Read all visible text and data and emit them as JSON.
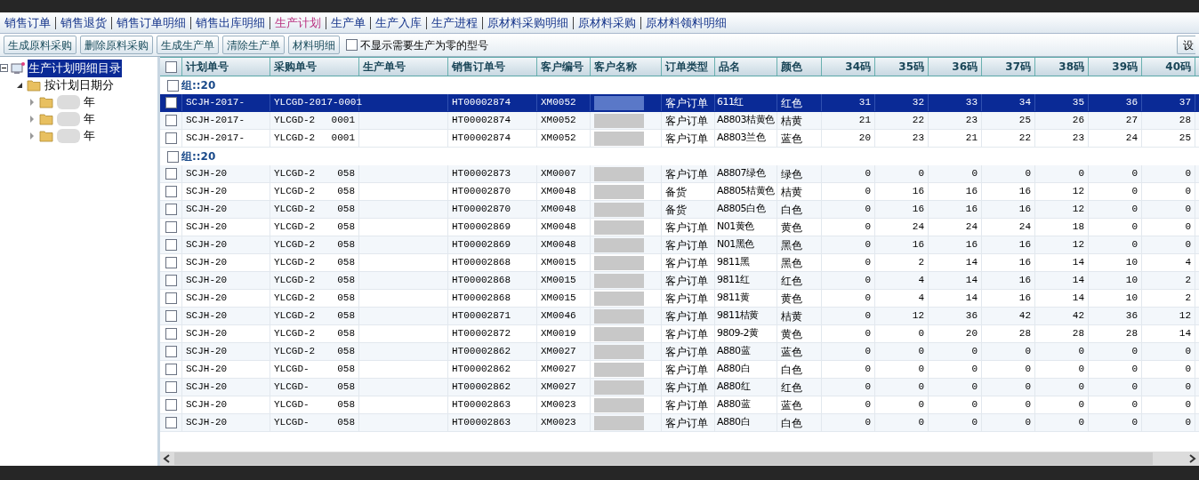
{
  "nav_tabs": [
    {
      "label": "销售订单",
      "selected": false
    },
    {
      "label": "销售退货",
      "selected": false
    },
    {
      "label": "销售订单明细",
      "selected": false
    },
    {
      "label": "销售出库明细",
      "selected": false
    },
    {
      "label": "生产计划",
      "selected": true
    },
    {
      "label": "生产单",
      "selected": false
    },
    {
      "label": "生产入库",
      "selected": false
    },
    {
      "label": "生产进程",
      "selected": false
    },
    {
      "label": "原材料采购明细",
      "selected": false
    },
    {
      "label": "原材料采购",
      "selected": false
    },
    {
      "label": "原材料领料明细",
      "selected": false
    }
  ],
  "toolbar": {
    "buttons": [
      "生成原料采购",
      "删除原料采购",
      "生成生产单",
      "清除生产单",
      "材料明细"
    ],
    "filter": {
      "label": "不显示需要生产为零的型号",
      "checked": false
    },
    "settings_button": "设"
  },
  "tree": {
    "label": "生产计划明细目录",
    "selected": true,
    "expanded": true,
    "children": [
      {
        "label": "按计划日期分",
        "expanded": true,
        "children": [
          {
            "label": "年",
            "expanded": false
          },
          {
            "label": "年",
            "expanded": false
          },
          {
            "label": "年",
            "expanded": false
          }
        ]
      }
    ]
  },
  "table": {
    "header_checked": false,
    "columns": [
      "计划单号",
      "采购单号",
      "生产单号",
      "销售订单号",
      "客户编号",
      "客户名称",
      "订单类型",
      "品名",
      "颜色",
      "34码",
      "35码",
      "36码",
      "37码",
      "38码",
      "39码",
      "40码"
    ],
    "groups": [
      {
        "label": "组::20",
        "checked": false,
        "rows": [
          {
            "plan_no": "SCJH-2017-",
            "purchase_no": "YLCGD-2017-0001",
            "sales_no": "HT00002874",
            "customer_no": "XM0052",
            "order_type": "客户订单",
            "product": "611红",
            "color_name": "红色",
            "sizes": [
              "31",
              "32",
              "33",
              "34",
              "35",
              "36",
              "37"
            ],
            "checked": false,
            "selected": true
          },
          {
            "plan_no": "SCJH-2017-",
            "purchase_no": "YLCGD-2",
            "purchase_tail": "0001",
            "sales_no": "HT00002874",
            "customer_no": "XM0052",
            "order_type": "客户订单",
            "product": "A8803桔黄色",
            "color_name": "桔黄",
            "sizes": [
              "21",
              "22",
              "23",
              "25",
              "26",
              "27",
              "28"
            ],
            "checked": false,
            "selected": false
          },
          {
            "plan_no": "SCJH-2017-",
            "purchase_no": "YLCGD-2",
            "purchase_tail": "0001",
            "sales_no": "HT00002874",
            "customer_no": "XM0052",
            "order_type": "客户订单",
            "product": "A8803兰色",
            "color_name": "蓝色",
            "sizes": [
              "20",
              "23",
              "21",
              "22",
              "23",
              "24",
              "25"
            ],
            "checked": false,
            "selected": false
          }
        ]
      },
      {
        "label": "组::20",
        "checked": false,
        "rows": [
          {
            "plan_no": "SCJH-20",
            "purchase_no": "YLCGD-2",
            "purchase_tail": "058",
            "sales_no": "HT00002873",
            "customer_no": "XM0007",
            "order_type": "客户订单",
            "product": "A8807绿色",
            "color_name": "绿色",
            "sizes": [
              "0",
              "0",
              "0",
              "0",
              "0",
              "0",
              "0"
            ],
            "checked": false,
            "selected": false
          },
          {
            "plan_no": "SCJH-20",
            "purchase_no": "YLCGD-2",
            "purchase_tail": "058",
            "sales_no": "HT00002870",
            "customer_no": "XM0048",
            "order_type": "备货",
            "product": "A8805桔黄色",
            "color_name": "桔黄",
            "sizes": [
              "0",
              "16",
              "16",
              "16",
              "12",
              "0",
              "0"
            ],
            "checked": false,
            "selected": false
          },
          {
            "plan_no": "SCJH-20",
            "purchase_no": "YLCGD-2",
            "purchase_tail": "058",
            "sales_no": "HT00002870",
            "customer_no": "XM0048",
            "order_type": "备货",
            "product": "A8805白色",
            "color_name": "白色",
            "sizes": [
              "0",
              "16",
              "16",
              "16",
              "12",
              "0",
              "0"
            ],
            "checked": false,
            "selected": false
          },
          {
            "plan_no": "SCJH-20",
            "purchase_no": "YLCGD-2",
            "purchase_tail": "058",
            "sales_no": "HT00002869",
            "customer_no": "XM0048",
            "order_type": "客户订单",
            "product": "N01黄色",
            "color_name": "黄色",
            "sizes": [
              "0",
              "24",
              "24",
              "24",
              "18",
              "0",
              "0"
            ],
            "checked": false,
            "selected": false
          },
          {
            "plan_no": "SCJH-20",
            "purchase_no": "YLCGD-2",
            "purchase_tail": "058",
            "sales_no": "HT00002869",
            "customer_no": "XM0048",
            "order_type": "客户订单",
            "product": "N01黑色",
            "color_name": "黑色",
            "sizes": [
              "0",
              "16",
              "16",
              "16",
              "12",
              "0",
              "0"
            ],
            "checked": false,
            "selected": false
          },
          {
            "plan_no": "SCJH-20",
            "purchase_no": "YLCGD-2",
            "purchase_tail": "058",
            "sales_no": "HT00002868",
            "customer_no": "XM0015",
            "order_type": "客户订单",
            "product": "9811黑",
            "color_name": "黑色",
            "sizes": [
              "0",
              "2",
              "14",
              "16",
              "14",
              "10",
              "4"
            ],
            "checked": false,
            "selected": false
          },
          {
            "plan_no": "SCJH-20",
            "purchase_no": "YLCGD-2",
            "purchase_tail": "058",
            "sales_no": "HT00002868",
            "customer_no": "XM0015",
            "order_type": "客户订单",
            "product": "9811红",
            "color_name": "红色",
            "sizes": [
              "0",
              "4",
              "14",
              "16",
              "14",
              "10",
              "2"
            ],
            "checked": false,
            "selected": false
          },
          {
            "plan_no": "SCJH-20",
            "purchase_no": "YLCGD-2",
            "purchase_tail": "058",
            "sales_no": "HT00002868",
            "customer_no": "XM0015",
            "order_type": "客户订单",
            "product": "9811黄",
            "color_name": "黄色",
            "sizes": [
              "0",
              "4",
              "14",
              "16",
              "14",
              "10",
              "2"
            ],
            "checked": false,
            "selected": false
          },
          {
            "plan_no": "SCJH-20",
            "purchase_no": "YLCGD-2",
            "purchase_tail": "058",
            "sales_no": "HT00002871",
            "customer_no": "XM0046",
            "order_type": "客户订单",
            "product": "9811桔黄",
            "color_name": "桔黄",
            "sizes": [
              "0",
              "12",
              "36",
              "42",
              "42",
              "36",
              "12"
            ],
            "checked": false,
            "selected": false
          },
          {
            "plan_no": "SCJH-20",
            "purchase_no": "YLCGD-2",
            "purchase_tail": "058",
            "sales_no": "HT00002872",
            "customer_no": "XM0019",
            "order_type": "客户订单",
            "product": "9809-2黄",
            "color_name": "黄色",
            "sizes": [
              "0",
              "0",
              "20",
              "28",
              "28",
              "28",
              "14"
            ],
            "checked": false,
            "selected": false
          },
          {
            "plan_no": "SCJH-20",
            "purchase_no": "YLCGD-2",
            "purchase_tail": "058",
            "sales_no": "HT00002862",
            "customer_no": "XM0027",
            "order_type": "客户订单",
            "product": "A880蓝",
            "color_name": "蓝色",
            "sizes": [
              "0",
              "0",
              "0",
              "0",
              "0",
              "0",
              "0"
            ],
            "checked": false,
            "selected": false
          },
          {
            "plan_no": "SCJH-20",
            "purchase_no": "YLCGD-",
            "purchase_tail": "058",
            "sales_no": "HT00002862",
            "customer_no": "XM0027",
            "order_type": "客户订单",
            "product": "A880白",
            "color_name": "白色",
            "sizes": [
              "0",
              "0",
              "0",
              "0",
              "0",
              "0",
              "0"
            ],
            "checked": false,
            "selected": false
          },
          {
            "plan_no": "SCJH-20",
            "purchase_no": "YLCGD-",
            "purchase_tail": "058",
            "sales_no": "HT00002862",
            "customer_no": "XM0027",
            "order_type": "客户订单",
            "product": "A880红",
            "color_name": "红色",
            "sizes": [
              "0",
              "0",
              "0",
              "0",
              "0",
              "0",
              "0"
            ],
            "checked": false,
            "selected": false
          },
          {
            "plan_no": "SCJH-20",
            "purchase_no": "YLCGD-",
            "purchase_tail": "058",
            "sales_no": "HT00002863",
            "customer_no": "XM0023",
            "order_type": "客户订单",
            "product": "A880蓝",
            "color_name": "蓝色",
            "sizes": [
              "0",
              "0",
              "0",
              "0",
              "0",
              "0",
              "0"
            ],
            "checked": false,
            "selected": false
          },
          {
            "plan_no": "SCJH-20",
            "purchase_no": "YLCGD-",
            "purchase_tail": "058",
            "sales_no": "HT00002863",
            "customer_no": "XM0023",
            "order_type": "客户订单",
            "product": "A880白",
            "color_name": "白色",
            "sizes": [
              "0",
              "0",
              "0",
              "0",
              "0",
              "0",
              "0"
            ],
            "checked": false,
            "selected": false
          }
        ]
      }
    ]
  }
}
